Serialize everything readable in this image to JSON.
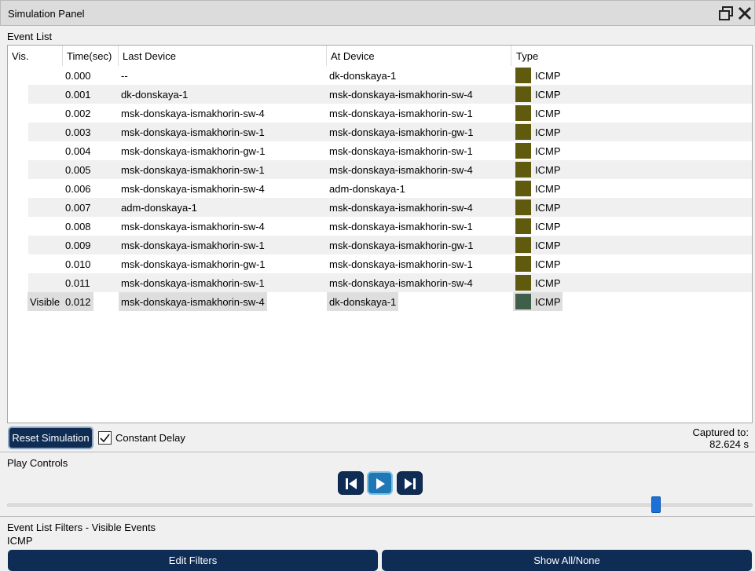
{
  "window": {
    "title": "Simulation Panel"
  },
  "event_list": {
    "label": "Event List",
    "columns": [
      "Vis.",
      "Time(sec)",
      "Last Device",
      "At Device",
      "Type"
    ],
    "rows": [
      {
        "vis": "",
        "time": "0.000",
        "last": "--",
        "at": "dk-donskaya-1",
        "type": "ICMP"
      },
      {
        "vis": "",
        "time": "0.001",
        "last": "dk-donskaya-1",
        "at": "msk-donskaya-ismakhorin-sw-4",
        "type": "ICMP"
      },
      {
        "vis": "",
        "time": "0.002",
        "last": "msk-donskaya-ismakhorin-sw-4",
        "at": "msk-donskaya-ismakhorin-sw-1",
        "type": "ICMP"
      },
      {
        "vis": "",
        "time": "0.003",
        "last": "msk-donskaya-ismakhorin-sw-1",
        "at": "msk-donskaya-ismakhorin-gw-1",
        "type": "ICMP"
      },
      {
        "vis": "",
        "time": "0.004",
        "last": "msk-donskaya-ismakhorin-gw-1",
        "at": "msk-donskaya-ismakhorin-sw-1",
        "type": "ICMP"
      },
      {
        "vis": "",
        "time": "0.005",
        "last": "msk-donskaya-ismakhorin-sw-1",
        "at": "msk-donskaya-ismakhorin-sw-4",
        "type": "ICMP"
      },
      {
        "vis": "",
        "time": "0.006",
        "last": "msk-donskaya-ismakhorin-sw-4",
        "at": "adm-donskaya-1",
        "type": "ICMP"
      },
      {
        "vis": "",
        "time": "0.007",
        "last": "adm-donskaya-1",
        "at": "msk-donskaya-ismakhorin-sw-4",
        "type": "ICMP"
      },
      {
        "vis": "",
        "time": "0.008",
        "last": "msk-donskaya-ismakhorin-sw-4",
        "at": "msk-donskaya-ismakhorin-sw-1",
        "type": "ICMP"
      },
      {
        "vis": "",
        "time": "0.009",
        "last": "msk-donskaya-ismakhorin-sw-1",
        "at": "msk-donskaya-ismakhorin-gw-1",
        "type": "ICMP"
      },
      {
        "vis": "",
        "time": "0.010",
        "last": "msk-donskaya-ismakhorin-gw-1",
        "at": "msk-donskaya-ismakhorin-sw-1",
        "type": "ICMP"
      },
      {
        "vis": "",
        "time": "0.011",
        "last": "msk-donskaya-ismakhorin-sw-1",
        "at": "msk-donskaya-ismakhorin-sw-4",
        "type": "ICMP"
      },
      {
        "vis": "Visible",
        "time": "0.012",
        "last": "msk-donskaya-ismakhorin-sw-4",
        "at": "dk-donskaya-1",
        "type": "ICMP",
        "selected": true
      }
    ]
  },
  "colors": {
    "icmp": "#5f5a0e",
    "icmp_selected": "#3f5f4a",
    "button_navy": "#0f2c55",
    "play_blue": "#1e78b5",
    "slider_blue": "#1a72d9"
  },
  "controls": {
    "reset_label": "Reset Simulation",
    "constant_delay_label": "Constant Delay",
    "constant_delay_checked": true,
    "captured_label": "Captured to:",
    "captured_value": "82.624 s"
  },
  "play_controls": {
    "label": "Play Controls",
    "icons": [
      "skip-back-icon",
      "play-icon",
      "skip-forward-icon"
    ],
    "slider_fraction": 0.87
  },
  "filters": {
    "label": "Event List Filters - Visible Events",
    "value": "ICMP",
    "edit_label": "Edit Filters",
    "show_all_label": "Show All/None"
  }
}
